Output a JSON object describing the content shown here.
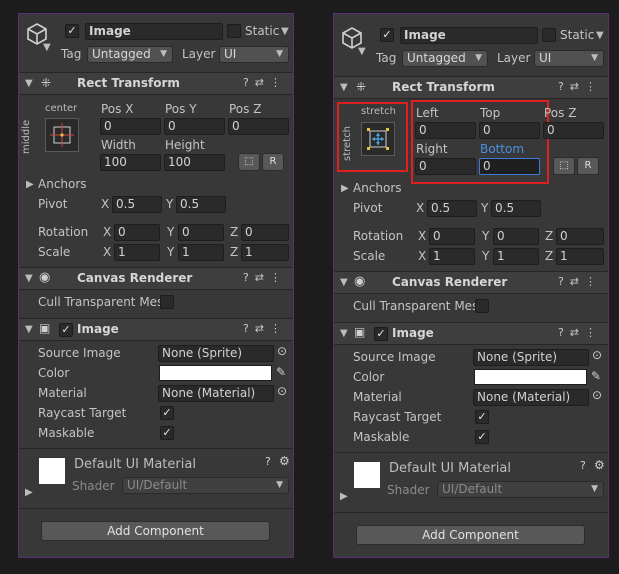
{
  "inspector": {
    "object_name": "Image",
    "static_label": "Static",
    "tag_label": "Tag",
    "tag_value": "Untagged",
    "layer_label": "Layer",
    "layer_value": "UI"
  },
  "rect_transform": {
    "title": "Rect Transform",
    "left_panel": {
      "anchor_h_label": "center",
      "anchor_v_label": "middle",
      "col1": "Pos X",
      "col2": "Pos Y",
      "col3": "Pos Z",
      "v1": "0",
      "v2": "0",
      "v3": "0",
      "col4": "Width",
      "col5": "Height",
      "v4": "100",
      "v5": "100"
    },
    "right_panel": {
      "anchor_h_label": "stretch",
      "anchor_v_label": "stretch",
      "col1": "Left",
      "col2": "Top",
      "col3": "Pos Z",
      "v1": "0",
      "v2": "0",
      "v3": "0",
      "col4": "Right",
      "col5": "Bottom",
      "v4": "0",
      "v5": "0"
    },
    "raw_button": "R",
    "anchors_label": "Anchors",
    "pivot_label": "Pivot",
    "pivot": {
      "x": "0.5",
      "y": "0.5"
    },
    "rotation_label": "Rotation",
    "rotation": {
      "x": "0",
      "y": "0",
      "z": "0"
    },
    "scale_label": "Scale",
    "scale": {
      "x": "1",
      "y": "1",
      "z": "1"
    },
    "axis": {
      "x": "X",
      "y": "Y",
      "z": "Z"
    }
  },
  "canvas_renderer": {
    "title": "Canvas Renderer",
    "cull_label": "Cull Transparent Mes"
  },
  "image_component": {
    "title": "Image",
    "source_image_label": "Source Image",
    "source_image_value": "None (Sprite)",
    "color_label": "Color",
    "color_value": "#ffffff",
    "material_label": "Material",
    "material_value": "None (Material)",
    "raycast_label": "Raycast Target",
    "maskable_label": "Maskable"
  },
  "material_preview": {
    "name": "Default UI Material",
    "shader_label": "Shader",
    "shader_value": "UI/Default"
  },
  "add_component": "Add Component",
  "colors": {
    "panel_bg": "#383838",
    "panel_border": "#5a2d77",
    "highlight": "#e02020",
    "focus": "#3d7bd9",
    "bottom_label_active": "#4a90e2"
  }
}
